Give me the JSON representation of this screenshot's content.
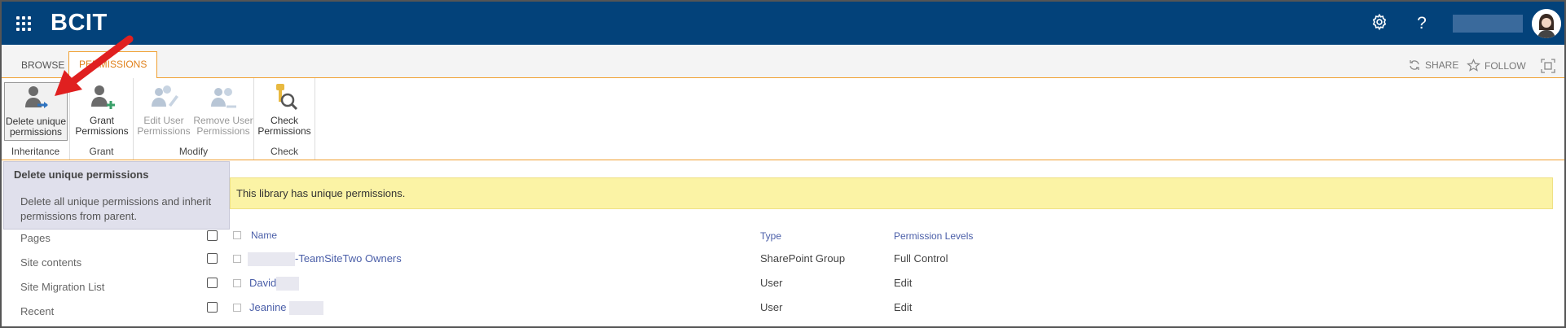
{
  "suitebar": {
    "brand": "BCIT",
    "icons": [
      "app-launcher-icon",
      "gear-icon",
      "help-icon"
    ],
    "help_glyph": "?",
    "colors": {
      "background": "#03427a",
      "text": "#ffffff"
    }
  },
  "ribbon_tabs": {
    "tabs": [
      {
        "label": "BROWSE",
        "active": false
      },
      {
        "label": "PERMISSIONS",
        "active": true
      }
    ],
    "actions": [
      {
        "label": "SHARE",
        "icon": "share-icon"
      },
      {
        "label": "FOLLOW",
        "icon": "star-icon"
      },
      {
        "icon": "focus-content-icon"
      }
    ]
  },
  "ribbon": {
    "groups": [
      {
        "label": "Inheritance",
        "buttons": [
          {
            "label_line1": "Delete unique",
            "label_line2": "permissions",
            "icon": "delete-permissions-icon",
            "enabled": true,
            "selected": true
          }
        ]
      },
      {
        "label": "Grant",
        "buttons": [
          {
            "label_line1": "Grant",
            "label_line2": "Permissions",
            "icon": "grant-permissions-icon",
            "enabled": true
          }
        ]
      },
      {
        "label": "Modify",
        "buttons": [
          {
            "label_line1": "Edit User",
            "label_line2": "Permissions",
            "icon": "edit-user-permissions-icon",
            "enabled": false
          },
          {
            "label_line1": "Remove User",
            "label_line2": "Permissions",
            "icon": "remove-user-permissions-icon",
            "enabled": false
          }
        ]
      },
      {
        "label": "Check",
        "buttons": [
          {
            "label_line1": "Check",
            "label_line2": "Permissions",
            "icon": "check-permissions-icon",
            "enabled": true
          }
        ]
      }
    ]
  },
  "tooltip": {
    "title": "Delete unique permissions",
    "body": "Delete all unique permissions and inherit permissions from parent."
  },
  "notice": {
    "text": "This library has unique permissions.",
    "color": "#fbf3a5"
  },
  "left_nav": {
    "items": [
      "Pages",
      "Site contents",
      "Site Migration List",
      "Recent"
    ]
  },
  "permissions_table": {
    "headers": {
      "name": "Name",
      "type": "Type",
      "levels": "Permission Levels"
    },
    "rows": [
      {
        "name": "-TeamSiteTwo Owners",
        "type": "SharePoint Group",
        "level": "Full Control"
      },
      {
        "name": "David",
        "type": "User",
        "level": "Edit"
      },
      {
        "name": "Jeanine",
        "type": "User",
        "level": "Edit"
      }
    ]
  },
  "annotation": {
    "arrow_color": "#e02020"
  }
}
